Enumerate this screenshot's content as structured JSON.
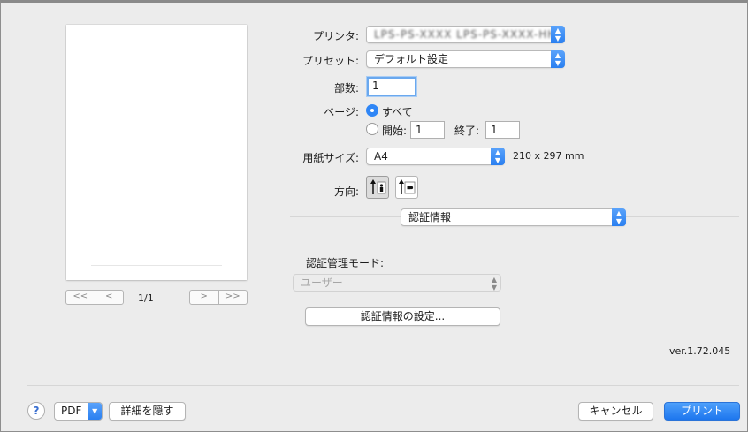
{
  "preview": {
    "page_indicator": "1/1",
    "nav_first": "<<",
    "nav_prev": "<",
    "nav_next": ">",
    "nav_last": ">>"
  },
  "printer": {
    "label": "プリンタ:",
    "value": "LPS-PS-XXXX LPS-PS-XXXX-HH"
  },
  "preset": {
    "label": "プリセット:",
    "value": "デフォルト設定"
  },
  "copies": {
    "label": "部数:",
    "value": "1"
  },
  "pages": {
    "label": "ページ:",
    "all_label": "すべて",
    "from_label": "開始:",
    "from_value": "1",
    "to_label": "終了:",
    "to_value": "1"
  },
  "paper": {
    "label": "用紙サイズ:",
    "value": "A4",
    "dimensions": "210 x 297 mm"
  },
  "orientation": {
    "label": "方向:"
  },
  "section_popup": {
    "value": "認証情報"
  },
  "auth": {
    "mode_label": "認証管理モード:",
    "mode_value": "ユーザー",
    "settings_button": "認証情報の設定..."
  },
  "version": "ver.1.72.045",
  "footer": {
    "help": "?",
    "pdf": "PDF",
    "hide_details": "詳細を隠す",
    "cancel": "キャンセル",
    "print": "プリント"
  },
  "colors": {
    "accent": "#2f86f6",
    "background": "#ececec"
  }
}
